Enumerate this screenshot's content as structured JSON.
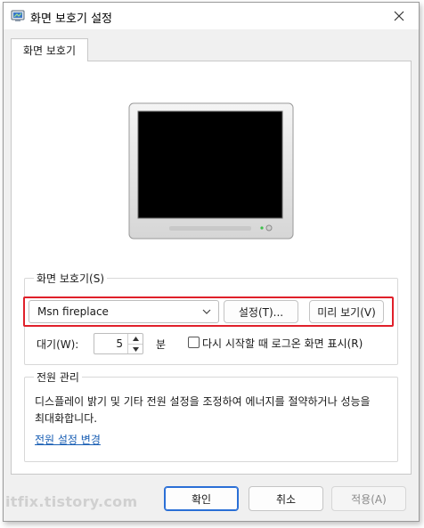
{
  "window": {
    "title": "화면 보호기 설정"
  },
  "tab": {
    "label": "화면 보호기"
  },
  "screensaver": {
    "group_label": "화면 보호기(S)",
    "selected": "Msn fireplace",
    "settings_label": "설정(T)...",
    "preview_label": "미리 보기(V)",
    "wait_label": "대기(W):",
    "wait_value": "5",
    "wait_unit": "분",
    "resume_label": "다시 시작할 때 로그온 화면 표시(R)",
    "resume_checked": false
  },
  "power": {
    "group_label": "전원 관리",
    "description": "디스플레이 밝기 및 기타 전원 설정을 조정하여 에너지를 절약하거나 성능을 최대화합니다.",
    "link": "전원 설정 변경"
  },
  "footer": {
    "ok_label": "확인",
    "cancel_label": "취소",
    "apply_label": "적용(A)"
  },
  "watermark": "itfix.tistory.com",
  "colors": {
    "highlight": "#e0202a",
    "link": "#1a5fb4",
    "accent": "#2a6fd6"
  }
}
